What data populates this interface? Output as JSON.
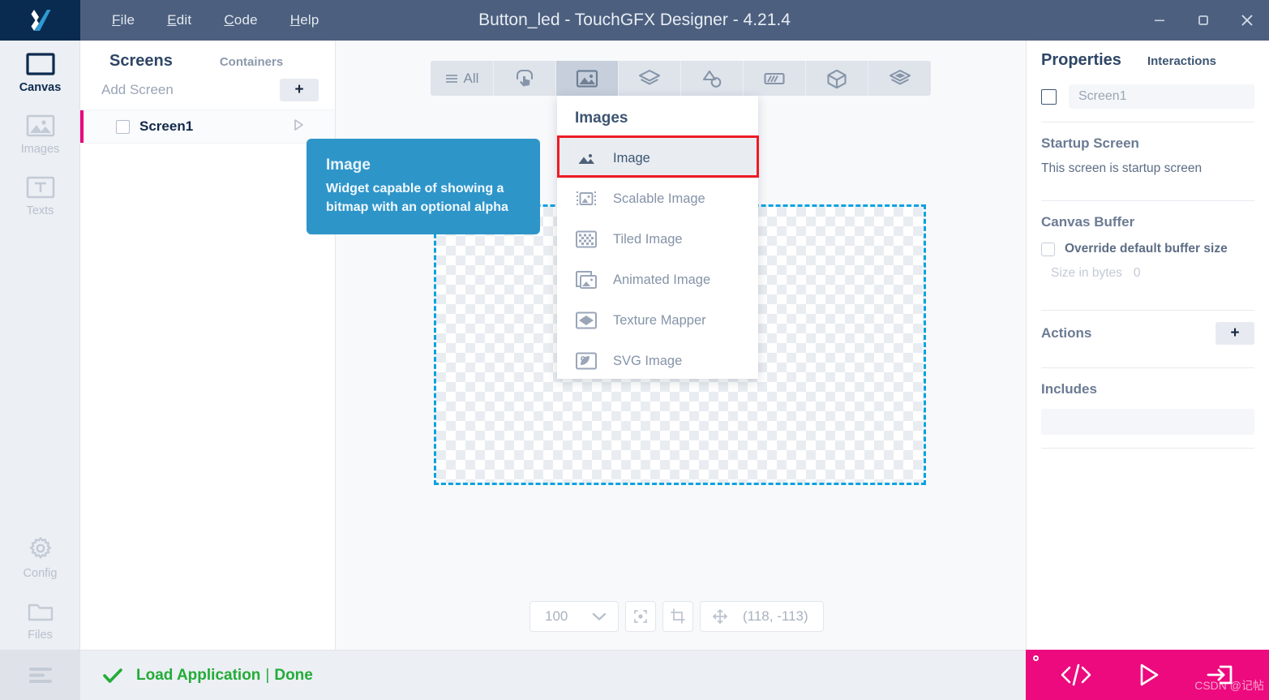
{
  "titlebar": {
    "logo": "touchgfx-x-logo",
    "title": "Button_led - TouchGFX Designer - 4.21.4",
    "menus": [
      {
        "label": "File",
        "accel": "F"
      },
      {
        "label": "Edit",
        "accel": "E"
      },
      {
        "label": "Code",
        "accel": "C"
      },
      {
        "label": "Help",
        "accel": "H"
      }
    ],
    "window_buttons": [
      {
        "name": "minimize",
        "glyph": "minimize-icon"
      },
      {
        "name": "maximize",
        "glyph": "maximize-icon"
      },
      {
        "name": "close",
        "glyph": "close-icon"
      }
    ]
  },
  "rail": {
    "items": [
      {
        "label": "Canvas",
        "icon": "canvas-rectangle-icon",
        "active": true
      },
      {
        "label": "Images",
        "icon": "images-picture-icon",
        "active": false
      },
      {
        "label": "Texts",
        "icon": "texts-t-icon",
        "active": false
      }
    ],
    "bottom_items": [
      {
        "label": "Config",
        "icon": "gear-icon",
        "active": false
      },
      {
        "label": "Files",
        "icon": "folder-icon",
        "active": false
      }
    ],
    "burger": "hamburger-menu-icon"
  },
  "screens_panel": {
    "tab_screens": "Screens",
    "tab_containers": "Containers",
    "add_screen_label": "Add Screen",
    "add_button": "+",
    "screens": [
      {
        "name": "Screen1",
        "selected": true
      }
    ]
  },
  "toolbar": {
    "buttons": [
      {
        "name": "all",
        "label": "All",
        "icon": "list-lines-icon",
        "active": false
      },
      {
        "name": "interactive",
        "label": "",
        "icon": "button-tap-icon",
        "active": false
      },
      {
        "name": "images",
        "label": "",
        "icon": "picture-icon",
        "active": true
      },
      {
        "name": "containers",
        "label": "",
        "icon": "layers-stack-icon",
        "active": false
      },
      {
        "name": "shapes",
        "label": "",
        "icon": "shapes-icon",
        "active": false
      },
      {
        "name": "progress",
        "label": "",
        "icon": "progress-bar-icon",
        "active": false
      },
      {
        "name": "miscellaneous",
        "label": "",
        "icon": "cube-box-icon",
        "active": false
      },
      {
        "name": "custom",
        "label": "",
        "icon": "layers-diamond-icon",
        "active": false
      }
    ]
  },
  "dropdown": {
    "title": "Images",
    "items": [
      {
        "label": "Image",
        "icon": "image-icon",
        "selected": true,
        "highlighted": true
      },
      {
        "label": "Scalable Image",
        "icon": "scalable-image-icon",
        "selected": false,
        "highlighted": false
      },
      {
        "label": "Tiled Image",
        "icon": "tiled-image-icon",
        "selected": false,
        "highlighted": false
      },
      {
        "label": "Animated Image",
        "icon": "animated-image-icon",
        "selected": false,
        "highlighted": false
      },
      {
        "label": "Texture Mapper",
        "icon": "texture-mapper-icon",
        "selected": false,
        "highlighted": false
      },
      {
        "label": "SVG Image",
        "icon": "svg-image-icon",
        "selected": false,
        "highlighted": false
      }
    ],
    "highlight_color": "#ee1c25"
  },
  "tooltip": {
    "title": "Image",
    "description": "Widget capable of showing a bitmap with an optional alpha",
    "background_color": "#2e95c9"
  },
  "zoom_bar": {
    "zoom_value": "100",
    "chevron": "chevron-down-icon",
    "center_button": "center-target-icon",
    "crop_button": "crop-icon",
    "move_icon": "move-arrows-icon",
    "coordinates": "(118, -113)"
  },
  "properties": {
    "tab_properties": "Properties",
    "tab_interactions": "Interactions",
    "name_value": "Screen1",
    "startup_screen_heading": "Startup Screen",
    "startup_screen_text": "This screen is startup screen",
    "canvas_buffer_heading": "Canvas Buffer",
    "override_label": "Override default buffer size",
    "size_in_bytes_label": "Size in bytes",
    "size_in_bytes_value": "0",
    "actions_heading": "Actions",
    "actions_add": "+",
    "includes_heading": "Includes",
    "includes_value": ""
  },
  "statusbar": {
    "check_icon": "check-mark-icon",
    "message": "Load Application",
    "separator": "|",
    "state": "Done",
    "color": "#22ac38"
  },
  "action_bar": {
    "background_color": "#ec0a7e",
    "buttons": [
      {
        "name": "generate-code",
        "icon": "code-brackets-icon"
      },
      {
        "name": "run-simulator",
        "icon": "play-triangle-icon"
      },
      {
        "name": "run-target",
        "icon": "run-arrow-icon"
      }
    ],
    "watermark": "CSDN @记帖"
  }
}
